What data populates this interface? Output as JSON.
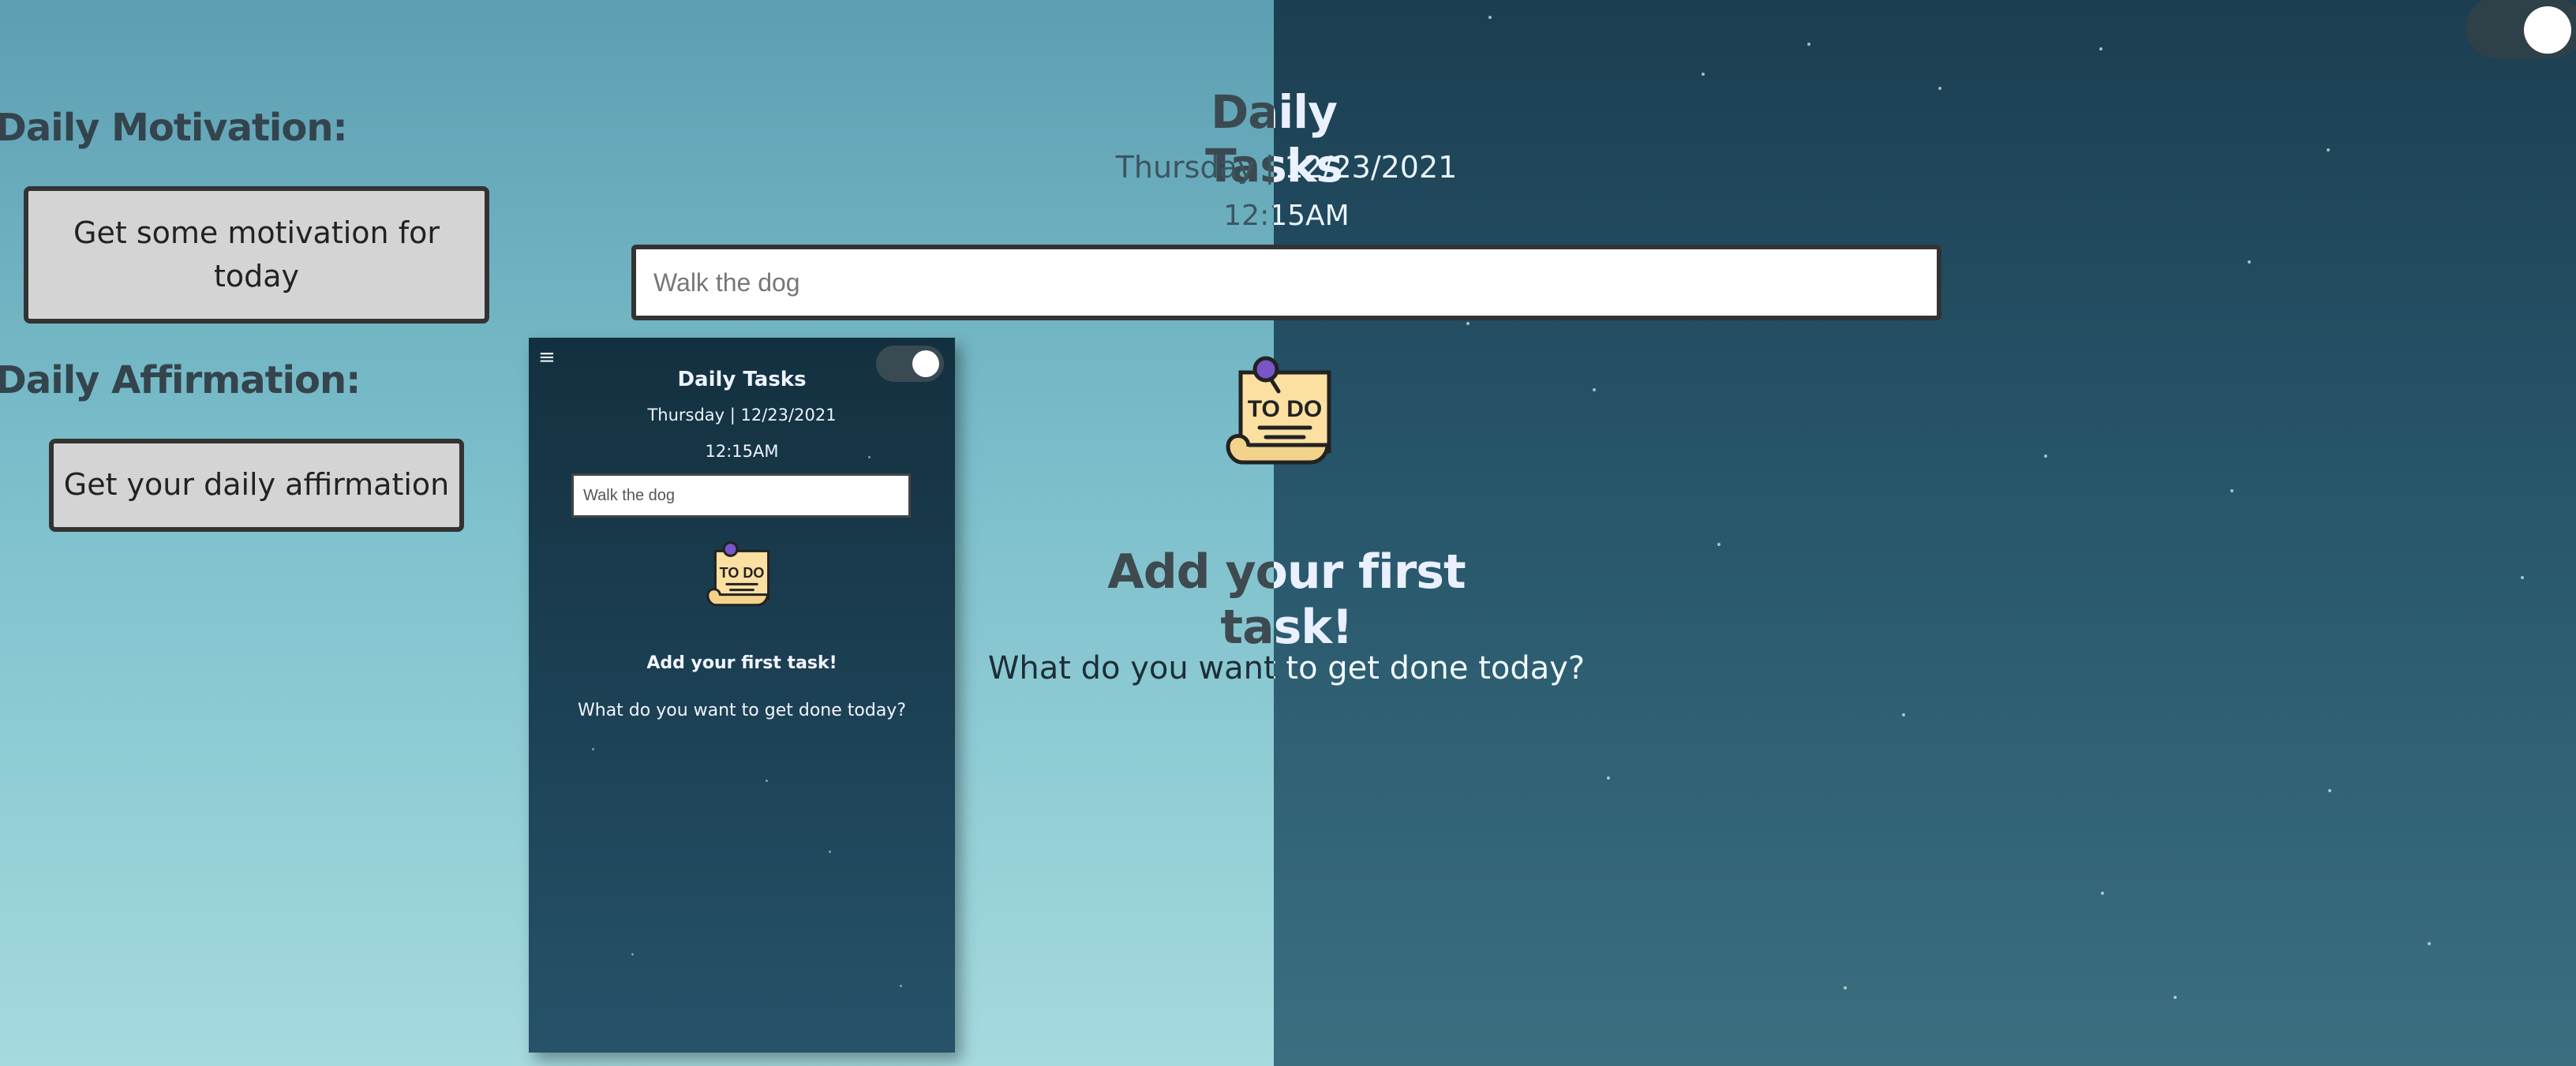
{
  "app": {
    "title": "Daily Tasks",
    "date": "Thursday | 12/23/2021",
    "time": "12:15AM",
    "input_placeholder": "Walk the dog",
    "todo_icon": "todo-note-icon",
    "empty_title": "Add your first task!",
    "empty_subtitle": "What do you want to get done today?"
  },
  "sidebar": {
    "motivation_heading": "Daily Motivation:",
    "motivation_button": "Get some motivation for today",
    "affirmation_heading": "Daily Affirmation:",
    "affirmation_button": "Get your daily affirmation"
  },
  "theme_toggle": {
    "state": "on"
  },
  "phone_preview": {
    "menu_icon": "hamburger-icon",
    "title": "Daily Tasks",
    "date": "Thursday | 12/23/2021",
    "time": "12:15AM",
    "input_placeholder": "Walk the dog",
    "empty_title": "Add your first task!",
    "empty_subtitle": "What do you want to get done today?"
  },
  "colors": {
    "light_bg": "#7cbfcb",
    "dark_bg": "#27556a",
    "button_bg": "#d4d4d4",
    "border": "#333333"
  }
}
